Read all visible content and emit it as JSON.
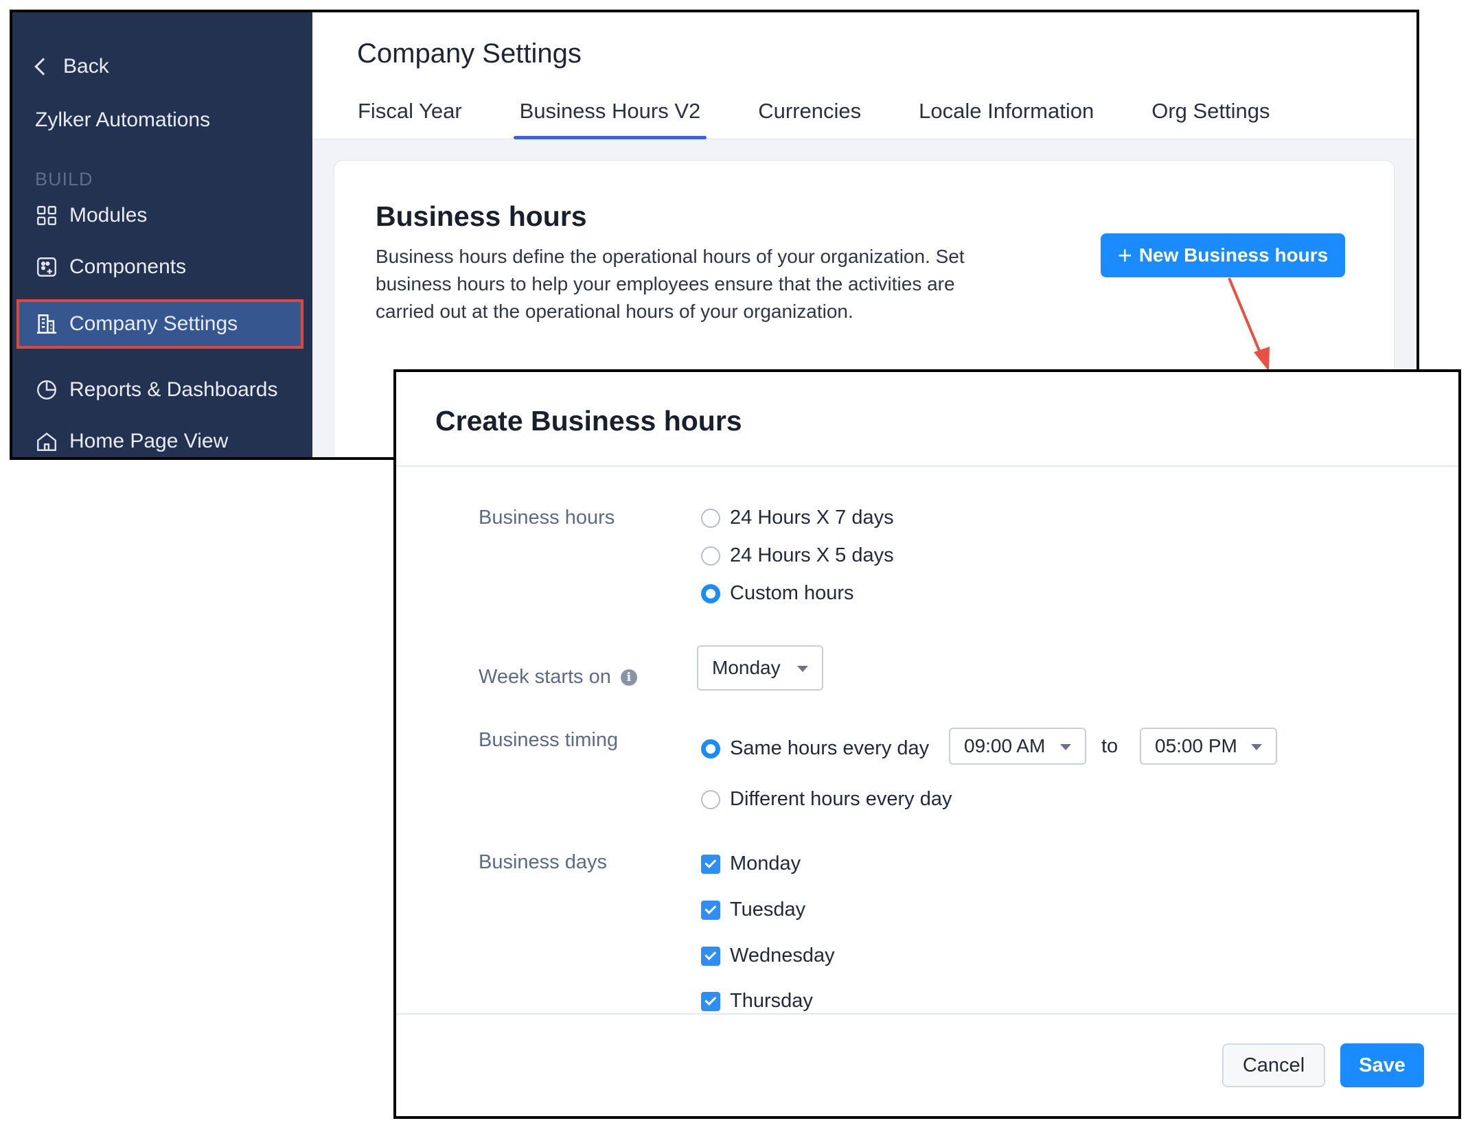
{
  "sidebar": {
    "back_label": "Back",
    "app_name": "Zylker Automations",
    "section_label": "BUILD",
    "items": [
      {
        "label": "Modules",
        "icon": "modules-icon"
      },
      {
        "label": "Components",
        "icon": "components-icon"
      },
      {
        "label": "Company Settings",
        "icon": "building-icon",
        "active": true
      },
      {
        "label": "Reports & Dashboards",
        "icon": "pie-chart-icon"
      },
      {
        "label": "Home Page View",
        "icon": "home-icon"
      }
    ]
  },
  "header": {
    "title": "Company Settings",
    "tabs": [
      {
        "label": "Fiscal Year"
      },
      {
        "label": "Business Hours V2",
        "active": true
      },
      {
        "label": "Currencies"
      },
      {
        "label": "Locale Information"
      },
      {
        "label": "Org Settings"
      }
    ]
  },
  "card": {
    "title": "Business hours",
    "description": "Business hours define the operational hours of your organization. Set business hours to help your employees ensure that the activities are carried out at the operational hours of your organization.",
    "new_button_label": "New Business hours",
    "new_button_icon": "plus-icon"
  },
  "modal": {
    "title": "Create Business hours",
    "business_hours": {
      "label": "Business hours",
      "options": [
        "24 Hours X 7 days",
        "24 Hours X 5 days",
        "Custom hours"
      ],
      "selected": "Custom hours"
    },
    "week_starts": {
      "label": "Week starts on",
      "value": "Monday"
    },
    "business_timing": {
      "label": "Business timing",
      "option_same": "Same hours every day",
      "option_different": "Different hours every day",
      "selected": "Same hours every day",
      "from": "09:00 AM",
      "to_label": "to",
      "to": "05:00 PM"
    },
    "business_days": {
      "label": "Business days",
      "days": [
        "Monday",
        "Tuesday",
        "Wednesday",
        "Thursday"
      ]
    },
    "cancel_label": "Cancel",
    "save_label": "Save"
  },
  "colors": {
    "sidebar_bg": "#243251",
    "sidebar_active": "#35568f",
    "highlight_red": "#e0463a",
    "accent_blue": "#1a8cff",
    "tab_underline": "#3d5ee8"
  }
}
